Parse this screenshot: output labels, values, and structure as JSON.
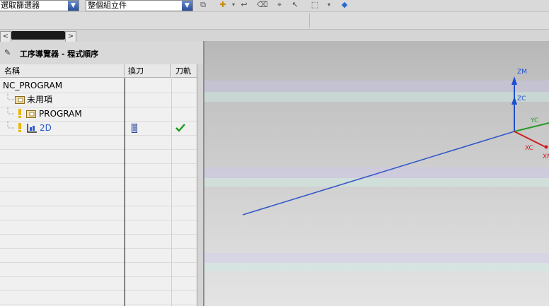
{
  "toolbar": {
    "filter_select": "選取篩選器",
    "scope_select": "整個組立件"
  },
  "navigator": {
    "title": "工序導覽器 - 程式順序",
    "columns": [
      "名稱",
      "換刀",
      "刀軌"
    ],
    "rows": [
      {
        "name": "NC_PROGRAM"
      },
      {
        "name": "未用項"
      },
      {
        "name": "PROGRAM"
      },
      {
        "name": "2D",
        "toolpath_ok": true
      }
    ]
  },
  "viewport": {
    "axis_labels": {
      "zm": "ZM",
      "zc": "ZC",
      "yc": "YC",
      "xc": "XC",
      "xm": "XM"
    },
    "colors": {
      "line": "#3558c8",
      "z_axis": "#1f4fd0",
      "y_axis": "#2a9a2a",
      "x_axis": "#d02020",
      "check": "#1a9a1a"
    }
  }
}
